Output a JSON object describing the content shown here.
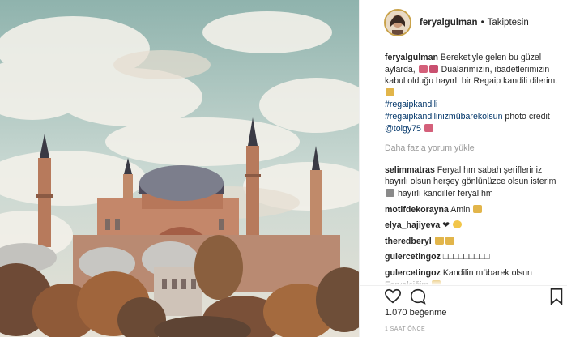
{
  "post": {
    "username": "ferya lgulman",
    "follow_status": "Takiptesin",
    "separator": "•"
  },
  "caption": {
    "username": "feryalgulman",
    "line1": "Bereketiyle gelen bu güzel aylarda,",
    "line2": "Dualarımızın, ibadetlerimizin kabul olduğu",
    "line3": "hayırlı bir Regaip kandili dilerim.",
    "hashtag1": "#regaipkandili",
    "hashtag2": "#regaipkandilinizmübarekolsun",
    "credit_text": "photo credit",
    "credit_user": "@tolgy75"
  },
  "load_more": "Daha fazla yorum yükle",
  "comments": [
    {
      "username": "selimmatras",
      "text": "Feryal hm sabah şerifleriniz hayırlı olsun herşey gönlünüzce olsun isterim",
      "text2": "hayırlı kandiller feryal hm"
    },
    {
      "username": "motifdekorayna",
      "text": "Amin"
    },
    {
      "username": "elya_hajiyeva",
      "text": "❤"
    },
    {
      "username": "theredberyl",
      "text": ""
    },
    {
      "username": "gulercetingoz",
      "text": "□□□□□□□□□"
    },
    {
      "username": "gulercetingoz",
      "text": "Kandilin mübarek olsun Feryalciğim"
    }
  ],
  "actions": {
    "icons": [
      "heart-icon",
      "comment-icon",
      "bookmark-icon"
    ],
    "likes": "1.070 beğenme",
    "time": "1 SAAT ÖNCE"
  },
  "colors": {
    "hashtag": "#003569",
    "muted": "#999999",
    "avatar_ring": "#c9a24a",
    "sky": "#8fb3ad"
  }
}
